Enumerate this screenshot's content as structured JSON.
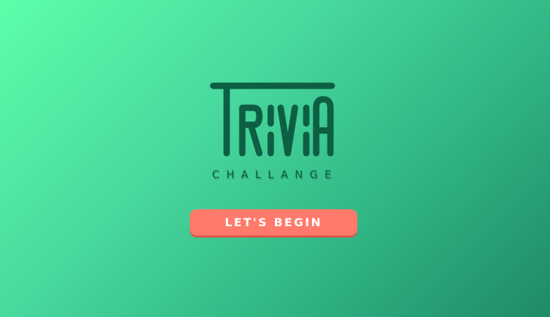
{
  "logo": {
    "icon": "trivia-wordmark",
    "wordmark": "TRIVIA",
    "color": "#0d5f44"
  },
  "subtitle": "CHALLANGE",
  "start_button": {
    "label": "LET'S BEGIN",
    "color": "#ff7a6a"
  },
  "background": {
    "gradient_start": "#5cffab",
    "gradient_end": "#1f8a67"
  }
}
